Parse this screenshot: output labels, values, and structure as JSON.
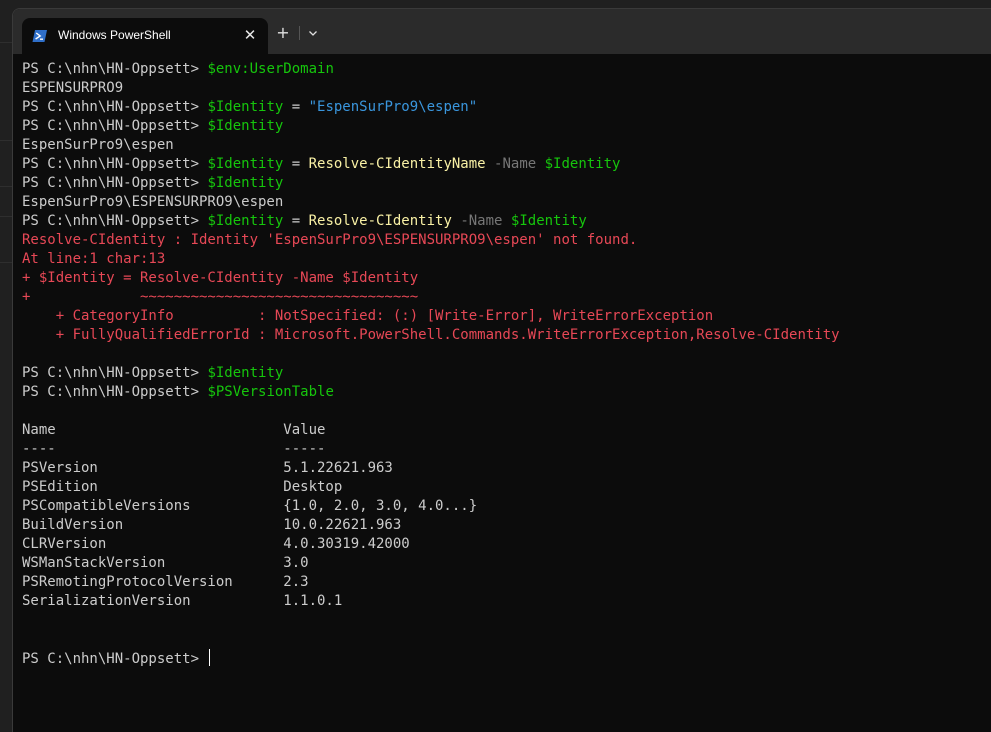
{
  "window": {
    "tab_title": "Windows PowerShell",
    "new_tab_label": "+",
    "close_label": "✕"
  },
  "terminal": {
    "prompt": "PS C:\\nhn\\HN-Oppsett> ",
    "lines": [
      {
        "type": "cmd",
        "parts": [
          {
            "t": "PS C:\\nhn\\HN-Oppsett> ",
            "c": "default"
          },
          {
            "t": "$env:UserDomain",
            "c": "var2"
          }
        ]
      },
      {
        "type": "out",
        "parts": [
          {
            "t": "ESPENSURPRO9",
            "c": "default"
          }
        ]
      },
      {
        "type": "cmd",
        "parts": [
          {
            "t": "PS C:\\nhn\\HN-Oppsett> ",
            "c": "default"
          },
          {
            "t": "$Identity",
            "c": "var2"
          },
          {
            "t": " = ",
            "c": "default"
          },
          {
            "t": "\"EspenSurPro9\\espen\"",
            "c": "str"
          }
        ]
      },
      {
        "type": "cmd",
        "parts": [
          {
            "t": "PS C:\\nhn\\HN-Oppsett> ",
            "c": "default"
          },
          {
            "t": "$Identity",
            "c": "var2"
          }
        ]
      },
      {
        "type": "out",
        "parts": [
          {
            "t": "EspenSurPro9\\espen",
            "c": "default"
          }
        ]
      },
      {
        "type": "cmd",
        "parts": [
          {
            "t": "PS C:\\nhn\\HN-Oppsett> ",
            "c": "default"
          },
          {
            "t": "$Identity",
            "c": "var2"
          },
          {
            "t": " = ",
            "c": "default"
          },
          {
            "t": "Resolve-CIdentityName",
            "c": "cmd"
          },
          {
            "t": " -Name ",
            "c": "param"
          },
          {
            "t": "$Identity",
            "c": "var2"
          }
        ]
      },
      {
        "type": "cmd",
        "parts": [
          {
            "t": "PS C:\\nhn\\HN-Oppsett> ",
            "c": "default"
          },
          {
            "t": "$Identity",
            "c": "var2"
          }
        ]
      },
      {
        "type": "out",
        "parts": [
          {
            "t": "EspenSurPro9\\ESPENSURPRO9\\espen",
            "c": "default"
          }
        ]
      },
      {
        "type": "cmd",
        "parts": [
          {
            "t": "PS C:\\nhn\\HN-Oppsett> ",
            "c": "default"
          },
          {
            "t": "$Identity",
            "c": "var2"
          },
          {
            "t": " = ",
            "c": "default"
          },
          {
            "t": "Resolve-CIdentity",
            "c": "cmd"
          },
          {
            "t": " -Name ",
            "c": "param"
          },
          {
            "t": "$Identity",
            "c": "var2"
          }
        ]
      },
      {
        "type": "err",
        "parts": [
          {
            "t": "Resolve-CIdentity : Identity 'EspenSurPro9\\ESPENSURPRO9\\espen' not found.",
            "c": "err"
          }
        ]
      },
      {
        "type": "err",
        "parts": [
          {
            "t": "At line:1 char:13",
            "c": "err"
          }
        ]
      },
      {
        "type": "err",
        "parts": [
          {
            "t": "+ $Identity = Resolve-CIdentity -Name $Identity",
            "c": "err"
          }
        ]
      },
      {
        "type": "err",
        "parts": [
          {
            "t": "+             ~~~~~~~~~~~~~~~~~~~~~~~~~~~~~~~~~",
            "c": "err"
          }
        ]
      },
      {
        "type": "err",
        "parts": [
          {
            "t": "    + CategoryInfo          : NotSpecified: (:) [Write-Error], WriteErrorException",
            "c": "err"
          }
        ]
      },
      {
        "type": "err",
        "parts": [
          {
            "t": "    + FullyQualifiedErrorId : Microsoft.PowerShell.Commands.WriteErrorException,Resolve-CIdentity",
            "c": "err"
          }
        ]
      },
      {
        "type": "blank",
        "parts": []
      },
      {
        "type": "cmd",
        "parts": [
          {
            "t": "PS C:\\nhn\\HN-Oppsett> ",
            "c": "default"
          },
          {
            "t": "$Identity",
            "c": "var2"
          }
        ]
      },
      {
        "type": "cmd",
        "parts": [
          {
            "t": "PS C:\\nhn\\HN-Oppsett> ",
            "c": "default"
          },
          {
            "t": "$PSVersionTable",
            "c": "var2"
          }
        ]
      },
      {
        "type": "blank",
        "parts": []
      },
      {
        "type": "out",
        "parts": [
          {
            "t": "Name                           Value",
            "c": "default"
          }
        ]
      },
      {
        "type": "out",
        "parts": [
          {
            "t": "----                           -----",
            "c": "default"
          }
        ]
      },
      {
        "type": "out",
        "parts": [
          {
            "t": "PSVersion                      5.1.22621.963",
            "c": "default"
          }
        ]
      },
      {
        "type": "out",
        "parts": [
          {
            "t": "PSEdition                      Desktop",
            "c": "default"
          }
        ]
      },
      {
        "type": "out",
        "parts": [
          {
            "t": "PSCompatibleVersions           {1.0, 2.0, 3.0, 4.0...}",
            "c": "default"
          }
        ]
      },
      {
        "type": "out",
        "parts": [
          {
            "t": "BuildVersion                   10.0.22621.963",
            "c": "default"
          }
        ]
      },
      {
        "type": "out",
        "parts": [
          {
            "t": "CLRVersion                     4.0.30319.42000",
            "c": "default"
          }
        ]
      },
      {
        "type": "out",
        "parts": [
          {
            "t": "WSManStackVersion              3.0",
            "c": "default"
          }
        ]
      },
      {
        "type": "out",
        "parts": [
          {
            "t": "PSRemotingProtocolVersion      2.3",
            "c": "default"
          }
        ]
      },
      {
        "type": "out",
        "parts": [
          {
            "t": "SerializationVersion           1.1.0.1",
            "c": "default"
          }
        ]
      },
      {
        "type": "blank",
        "parts": []
      },
      {
        "type": "blank",
        "parts": []
      },
      {
        "type": "prompt",
        "parts": [
          {
            "t": "PS C:\\nhn\\HN-Oppsett> ",
            "c": "default"
          }
        ]
      }
    ]
  },
  "colors": {
    "background": "#0c0c0c",
    "tabbar": "#2b2b2b",
    "variable": "#16c60c",
    "string": "#3a96dd",
    "command": "#f9f1a5",
    "parameter": "#767676",
    "error": "#e74856"
  },
  "icons": {
    "tab_icon": "powershell-icon",
    "close": "close-icon",
    "new_tab": "plus-icon",
    "dropdown": "chevron-down-icon"
  }
}
